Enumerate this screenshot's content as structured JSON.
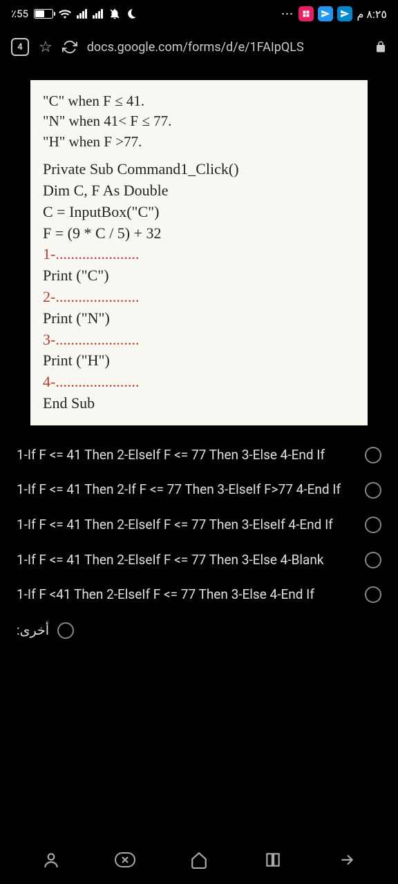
{
  "status": {
    "battery": "٪55",
    "time": "٨:٢٥ م"
  },
  "urlbar": {
    "tabcount": "4",
    "url": "docs.google.com/forms/d/e/1FAIpQLS"
  },
  "code": {
    "rule1": "\"C\" when F ≤ 41.",
    "rule2": "\"N\" when 41< F ≤ 77.",
    "rule3": "\"H\" when F >77.",
    "line1": "Private Sub Command1_Click()",
    "line2": "Dim C, F As Double",
    "line3": "C = InputBox(\"C\")",
    "line4": "F = (9 * C / 5) + 32",
    "blank1": "1-......................",
    "line5": "Print (\"C\")",
    "blank2": "2-......................",
    "line6": "Print (\"N\")",
    "blank3": "3-......................",
    "line7": "Print (\"H\")",
    "blank4": "4-......................",
    "line8": "End Sub"
  },
  "options": [
    "1-If F <= 41 Then 2-ElseIf F <= 77 Then 3-Else 4-End If",
    "1-If F <= 41 Then 2-If F <= 77 Then 3-ElseIf F>77 4-End If",
    "1-If F <= 41 Then 2-ElseIf F <= 77 Then 3-ElseIf 4-End If",
    "1-If F <= 41 Then 2-ElseIf F <= 77 Then 3-Else 4-Blank",
    "1-If F <41 Then 2-ElseIf F <= 77 Then 3-Else 4-End If"
  ],
  "other_label": "أخرى:"
}
